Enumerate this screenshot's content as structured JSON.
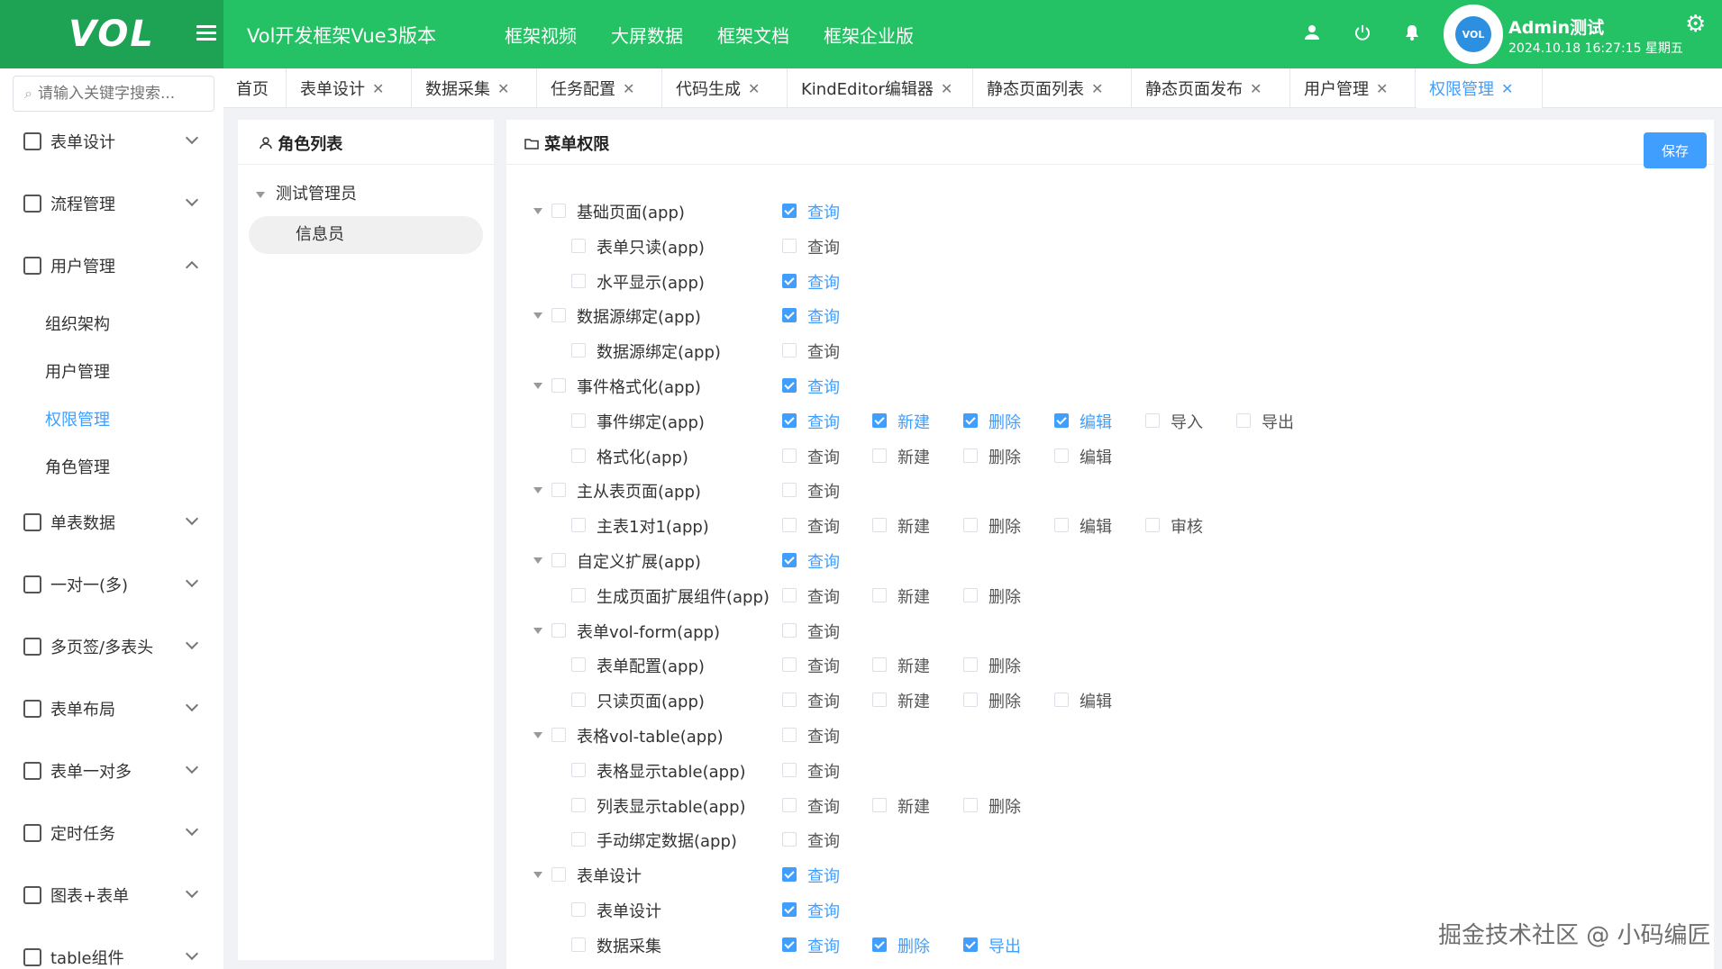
{
  "header": {
    "logo": "VOL",
    "app_title": "Vol开发框架Vue3版本",
    "nav": [
      "框架视频",
      "大屏数据",
      "框架文档",
      "框架企业版"
    ],
    "user_name": "Admin测试",
    "user_time": "2024.10.18 16:27:15 星期五",
    "avatar_text": "VOL"
  },
  "sidebar": {
    "search_placeholder": "请输入关键字搜索...",
    "menus": [
      {
        "label": "表单设计",
        "icon": "form-icon",
        "expanded": false
      },
      {
        "label": "流程管理",
        "icon": "flow-icon",
        "expanded": false
      },
      {
        "label": "用户管理",
        "icon": "user-icon",
        "expanded": true
      },
      {
        "label": "单表数据",
        "icon": "table-icon",
        "expanded": false
      },
      {
        "label": "一对一(多)",
        "icon": "copy-icon",
        "expanded": false
      },
      {
        "label": "多页签/多表头",
        "icon": "doc-icon",
        "expanded": false
      },
      {
        "label": "表单布局",
        "icon": "layout-icon",
        "expanded": false
      },
      {
        "label": "表单一对多",
        "icon": "grid-icon",
        "expanded": false
      },
      {
        "label": "定时任务",
        "icon": "clock-icon",
        "expanded": false
      },
      {
        "label": "图表+表单",
        "icon": "fullscreen-icon",
        "expanded": false
      },
      {
        "label": "table组件",
        "icon": "table-icon",
        "expanded": false
      }
    ],
    "sub_items": [
      "组织架构",
      "用户管理",
      "权限管理",
      "角色管理"
    ],
    "active_sub": "权限管理"
  },
  "tabs": [
    {
      "label": "首页",
      "closable": false
    },
    {
      "label": "表单设计",
      "closable": true
    },
    {
      "label": "数据采集",
      "closable": true
    },
    {
      "label": "任务配置",
      "closable": true
    },
    {
      "label": "代码生成",
      "closable": true
    },
    {
      "label": "KindEditor编辑器",
      "closable": true
    },
    {
      "label": "静态页面列表",
      "closable": true
    },
    {
      "label": "静态页面发布",
      "closable": true
    },
    {
      "label": "用户管理",
      "closable": true
    },
    {
      "label": "权限管理",
      "closable": true,
      "active": true
    }
  ],
  "role_panel": {
    "title": "角色列表",
    "root": "测试管理员",
    "child": "信息员"
  },
  "perm_panel": {
    "title": "菜单权限",
    "save_label": "保存",
    "nodes": [
      {
        "label": "基础页面(app)",
        "level": 0,
        "actions": [
          {
            "label": "查询",
            "checked": true
          }
        ]
      },
      {
        "label": "表单只读(app)",
        "level": 1,
        "actions": [
          {
            "label": "查询",
            "checked": false
          }
        ]
      },
      {
        "label": "水平显示(app)",
        "level": 1,
        "actions": [
          {
            "label": "查询",
            "checked": true
          }
        ]
      },
      {
        "label": "数据源绑定(app)",
        "level": 0,
        "actions": [
          {
            "label": "查询",
            "checked": true
          }
        ]
      },
      {
        "label": "数据源绑定(app)",
        "level": 1,
        "actions": [
          {
            "label": "查询",
            "checked": false
          }
        ]
      },
      {
        "label": "事件格式化(app)",
        "level": 0,
        "actions": [
          {
            "label": "查询",
            "checked": true
          }
        ]
      },
      {
        "label": "事件绑定(app)",
        "level": 1,
        "actions": [
          {
            "label": "查询",
            "checked": true
          },
          {
            "label": "新建",
            "checked": true
          },
          {
            "label": "删除",
            "checked": true
          },
          {
            "label": "编辑",
            "checked": true
          },
          {
            "label": "导入",
            "checked": false
          },
          {
            "label": "导出",
            "checked": false
          }
        ]
      },
      {
        "label": "格式化(app)",
        "level": 1,
        "actions": [
          {
            "label": "查询",
            "checked": false
          },
          {
            "label": "新建",
            "checked": false
          },
          {
            "label": "删除",
            "checked": false
          },
          {
            "label": "编辑",
            "checked": false
          }
        ]
      },
      {
        "label": "主从表页面(app)",
        "level": 0,
        "actions": [
          {
            "label": "查询",
            "checked": false
          }
        ]
      },
      {
        "label": "主表1对1(app)",
        "level": 1,
        "actions": [
          {
            "label": "查询",
            "checked": false
          },
          {
            "label": "新建",
            "checked": false
          },
          {
            "label": "删除",
            "checked": false
          },
          {
            "label": "编辑",
            "checked": false
          },
          {
            "label": "审核",
            "checked": false
          }
        ]
      },
      {
        "label": "自定义扩展(app)",
        "level": 0,
        "actions": [
          {
            "label": "查询",
            "checked": true
          }
        ]
      },
      {
        "label": "生成页面扩展组件(app)",
        "level": 1,
        "actions": [
          {
            "label": "查询",
            "checked": false
          },
          {
            "label": "新建",
            "checked": false
          },
          {
            "label": "删除",
            "checked": false
          }
        ]
      },
      {
        "label": "表单vol-form(app)",
        "level": 0,
        "actions": [
          {
            "label": "查询",
            "checked": false
          }
        ]
      },
      {
        "label": "表单配置(app)",
        "level": 1,
        "actions": [
          {
            "label": "查询",
            "checked": false
          },
          {
            "label": "新建",
            "checked": false
          },
          {
            "label": "删除",
            "checked": false
          }
        ]
      },
      {
        "label": "只读页面(app)",
        "level": 1,
        "actions": [
          {
            "label": "查询",
            "checked": false
          },
          {
            "label": "新建",
            "checked": false
          },
          {
            "label": "删除",
            "checked": false
          },
          {
            "label": "编辑",
            "checked": false
          }
        ]
      },
      {
        "label": "表格vol-table(app)",
        "level": 0,
        "actions": [
          {
            "label": "查询",
            "checked": false
          }
        ]
      },
      {
        "label": "表格显示table(app)",
        "level": 1,
        "actions": [
          {
            "label": "查询",
            "checked": false
          }
        ]
      },
      {
        "label": "列表显示table(app)",
        "level": 1,
        "actions": [
          {
            "label": "查询",
            "checked": false
          },
          {
            "label": "新建",
            "checked": false
          },
          {
            "label": "删除",
            "checked": false
          }
        ]
      },
      {
        "label": "手动绑定数据(app)",
        "level": 1,
        "actions": [
          {
            "label": "查询",
            "checked": false
          }
        ]
      },
      {
        "label": "表单设计",
        "level": 0,
        "actions": [
          {
            "label": "查询",
            "checked": true
          }
        ]
      },
      {
        "label": "表单设计",
        "level": 1,
        "actions": [
          {
            "label": "查询",
            "checked": true
          }
        ]
      },
      {
        "label": "数据采集",
        "level": 1,
        "actions": [
          {
            "label": "查询",
            "checked": true
          },
          {
            "label": "删除",
            "checked": true
          },
          {
            "label": "导出",
            "checked": true
          }
        ]
      }
    ]
  },
  "watermark": "掘金技术社区 @ 小码编匠",
  "colors": {
    "header_green": "#24c264",
    "logo_green": "#1ea355",
    "accent_blue": "#409eff"
  }
}
